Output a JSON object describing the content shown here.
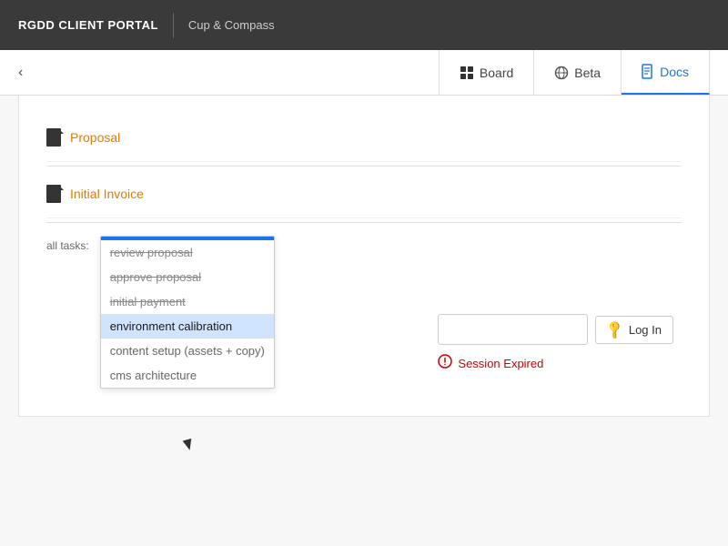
{
  "topbar": {
    "brand": "RGDD CLIENT PORTAL",
    "client": "Cup & Compass"
  },
  "tabs": [
    {
      "id": "board",
      "label": "Board",
      "icon": "board-icon",
      "active": false
    },
    {
      "id": "beta",
      "label": "Beta",
      "icon": "globe-icon",
      "active": false
    },
    {
      "id": "docs",
      "label": "Docs",
      "icon": "doc-icon",
      "active": true
    }
  ],
  "back_label": "‹",
  "sections": [
    {
      "id": "proposal",
      "label": "Proposal"
    },
    {
      "id": "initial-invoice",
      "label": "Initial Invoice"
    }
  ],
  "tasks_label": "all tasks:",
  "tasks": [
    {
      "id": "review-proposal",
      "label": "review proposal",
      "state": "strikethrough"
    },
    {
      "id": "approve-proposal",
      "label": "approve proposal",
      "state": "strikethrough"
    },
    {
      "id": "initial-payment",
      "label": "initial payment",
      "state": "strikethrough"
    },
    {
      "id": "environment-calibration",
      "label": "environment calibration",
      "state": "active"
    },
    {
      "id": "content-setup",
      "label": "content setup (assets + copy)",
      "state": "normal"
    },
    {
      "id": "cms-architecture",
      "label": "cms architecture",
      "state": "normal"
    }
  ],
  "login": {
    "input_placeholder": "",
    "button_label": "Log In",
    "key_icon": "🔑"
  },
  "session_expired": {
    "icon": "ⓘ",
    "text": "Session Expired"
  }
}
